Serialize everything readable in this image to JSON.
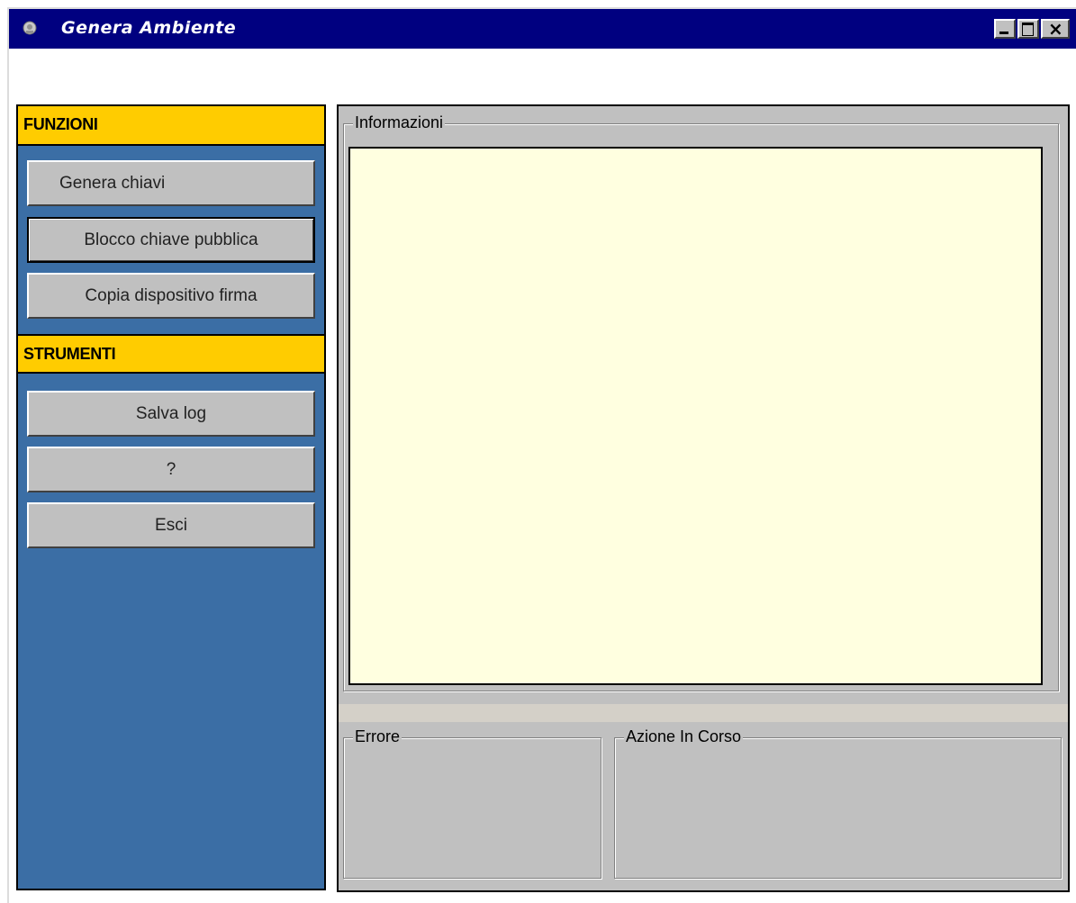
{
  "window": {
    "title": "Genera Ambiente",
    "icon": "app-emblem-icon",
    "controls": [
      "minimize-icon",
      "maximize-icon",
      "close-icon"
    ]
  },
  "sidebar": {
    "funzioni_header": "FUNZIONI",
    "funzioni_buttons": [
      {
        "label": "Genera chiavi"
      },
      {
        "label": "Blocco chiave pubblica"
      },
      {
        "label": "Copia dispositivo firma"
      }
    ],
    "strumenti_header": "STRUMENTI",
    "strumenti_buttons": [
      {
        "label": "Salva log"
      },
      {
        "label": "?"
      },
      {
        "label": "Esci"
      }
    ]
  },
  "main": {
    "info_label": "Informazioni",
    "info_text": "",
    "errore_label": "Errore",
    "azione_label": "Azione In Corso"
  },
  "colors": {
    "titlebar": "#000080",
    "sidebar_bg": "#3b6ea5",
    "section_header": "#ffcc00",
    "info_bg": "#ffffe0"
  }
}
